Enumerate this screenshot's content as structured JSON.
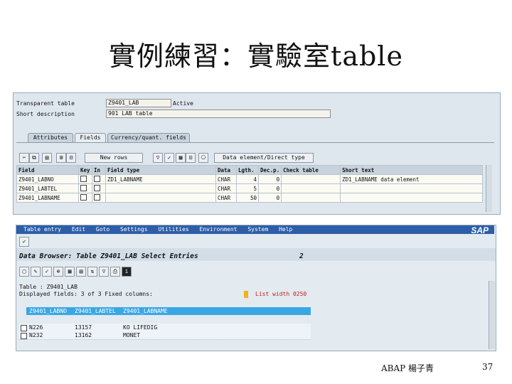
{
  "slide_title": "實例練習：實驗室table",
  "footer_left": "ABAP 楊子青",
  "page_number": "37",
  "dict": {
    "label_table": "Transparent table",
    "value_table": "Z9401_LAB",
    "status": "Active",
    "label_desc": "Short description",
    "value_desc": "901 LAB table",
    "tabs": [
      "Attributes",
      "Fields",
      "Currency/quant. fields"
    ],
    "new_rows": "New rows",
    "data_element": "Data element/Direct type",
    "columns": [
      "Field",
      "Key",
      "In",
      "Field type",
      "Data",
      "Lgth.",
      "Dec.p.",
      "Check table",
      "Short text"
    ],
    "rows": [
      {
        "field": "Z9401_LABNO",
        "field_type": "ZD1_LABNAME",
        "data": "CHAR",
        "len": "4",
        "dec": "0",
        "text": "ZD1_LABNAME data element"
      },
      {
        "field": "Z9401_LABTEL",
        "field_type": "",
        "data": "CHAR",
        "len": "5",
        "dec": "0",
        "text": ""
      },
      {
        "field": "Z9401_LABNAME",
        "field_type": "",
        "data": "CHAR",
        "len": "50",
        "dec": "0",
        "text": ""
      }
    ]
  },
  "browser": {
    "menu": [
      "Table entry",
      "Edit",
      "Goto",
      "Settings",
      "Utilities",
      "Environment",
      "System",
      "Help"
    ],
    "logo": "SAP",
    "header": "Data Browser: Table Z9401_LAB Select Entries",
    "count": "2",
    "table_line": "Table : Z9401_LAB",
    "displayed_line": "Displayed fields: 3 of 3 Fixed columns:",
    "list_width": "List width 0250",
    "col_headers": [
      "Z9401_LABNO",
      "Z9401_LABTEL",
      "Z9401_LABNAME"
    ],
    "rows": [
      {
        "no": "N226",
        "tel": "13157",
        "name": "KO LIFEDIG"
      },
      {
        "no": "N232",
        "tel": "13162",
        "name": "MONET"
      }
    ]
  }
}
